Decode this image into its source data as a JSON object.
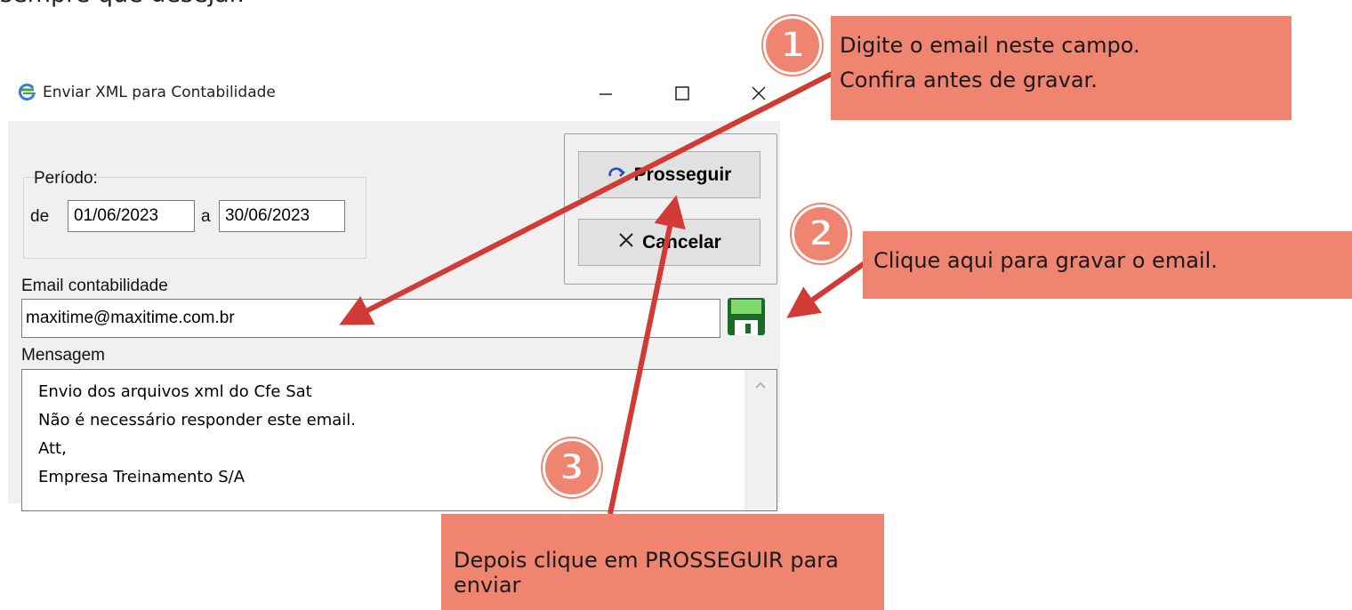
{
  "intro_text": "sempre que desejar.",
  "window": {
    "title": "Enviar XML para Contabilidade",
    "icon": "refresh-arrow-icon",
    "controls": {
      "minimize": "minimize-icon",
      "maximize": "maximize-icon",
      "close": "close-icon"
    }
  },
  "periodo": {
    "label": "Período:",
    "from_label": "de",
    "from_value": "01/06/2023",
    "to_label": "a",
    "to_value": "30/06/2023"
  },
  "buttons": {
    "prosseguir": "Prosseguir",
    "cancelar": "Cancelar"
  },
  "email": {
    "label": "Email contabilidade",
    "value": "maxitime@maxitime.com.br",
    "save_icon": "floppy-disk-icon"
  },
  "mensagem": {
    "label": "Mensagem",
    "lines": [
      "Envio dos arquivos xml do Cfe Sat",
      "Não é necessário responder este email.",
      "Att,",
      "Empresa Treinamento S/A"
    ]
  },
  "callouts": [
    {
      "number": "1",
      "lines": [
        "Digite o email neste campo.",
        "Confira antes de gravar."
      ]
    },
    {
      "number": "2",
      "lines": [
        "Clique aqui para gravar o email."
      ]
    },
    {
      "number": "3",
      "lines": [
        "Depois clique em PROSSEGUIR para enviar"
      ]
    }
  ],
  "colors": {
    "callout": "#ef8470",
    "arrow": "#d23a36",
    "window_bg": "#f0f0f0",
    "save_icon": "#2e9a3a"
  }
}
